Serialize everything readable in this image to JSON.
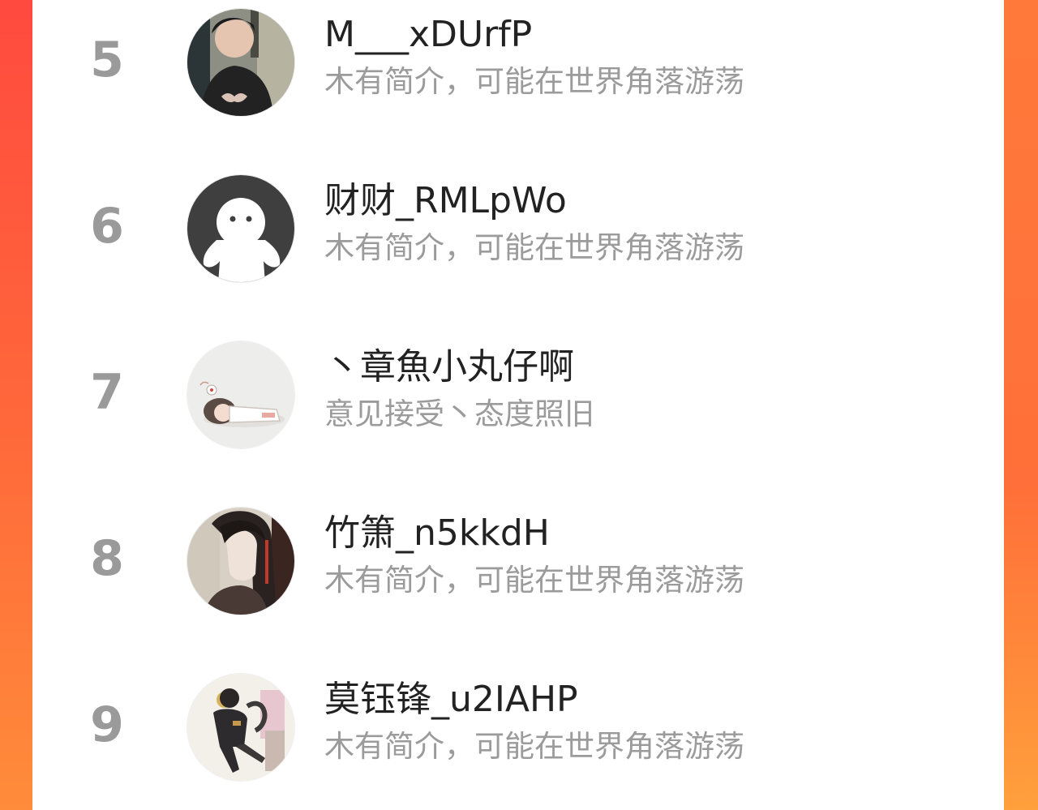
{
  "ranking": {
    "items": [
      {
        "rank": "5",
        "name": "M___xDUrfP",
        "bio": "木有简介，可能在世界角落游荡",
        "avatar_icon": "user-photo-icon"
      },
      {
        "rank": "6",
        "name": "财财_RMLpWo",
        "bio": "木有简介，可能在世界角落游荡",
        "avatar_icon": "default-avatar-icon"
      },
      {
        "rank": "7",
        "name": "丶章魚小丸仔啊",
        "bio": "意见接受丶态度照旧",
        "avatar_icon": "sleeping-character-icon"
      },
      {
        "rank": "8",
        "name": "竹箫_n5kkdH",
        "bio": "木有简介，可能在世界角落游荡",
        "avatar_icon": "anime-portrait-icon"
      },
      {
        "rank": "9",
        "name": "莫钰锋_u2IAHP",
        "bio": "木有简介，可能在世界角落游荡",
        "avatar_icon": "anime-figure-icon"
      }
    ]
  },
  "colors": {
    "background_gradient_top": "#ff4a3f",
    "background_gradient_bottom": "#ff8c3a",
    "rank_text": "#9a9a9a",
    "name_text": "#222222",
    "bio_text": "#9b9b9b"
  }
}
